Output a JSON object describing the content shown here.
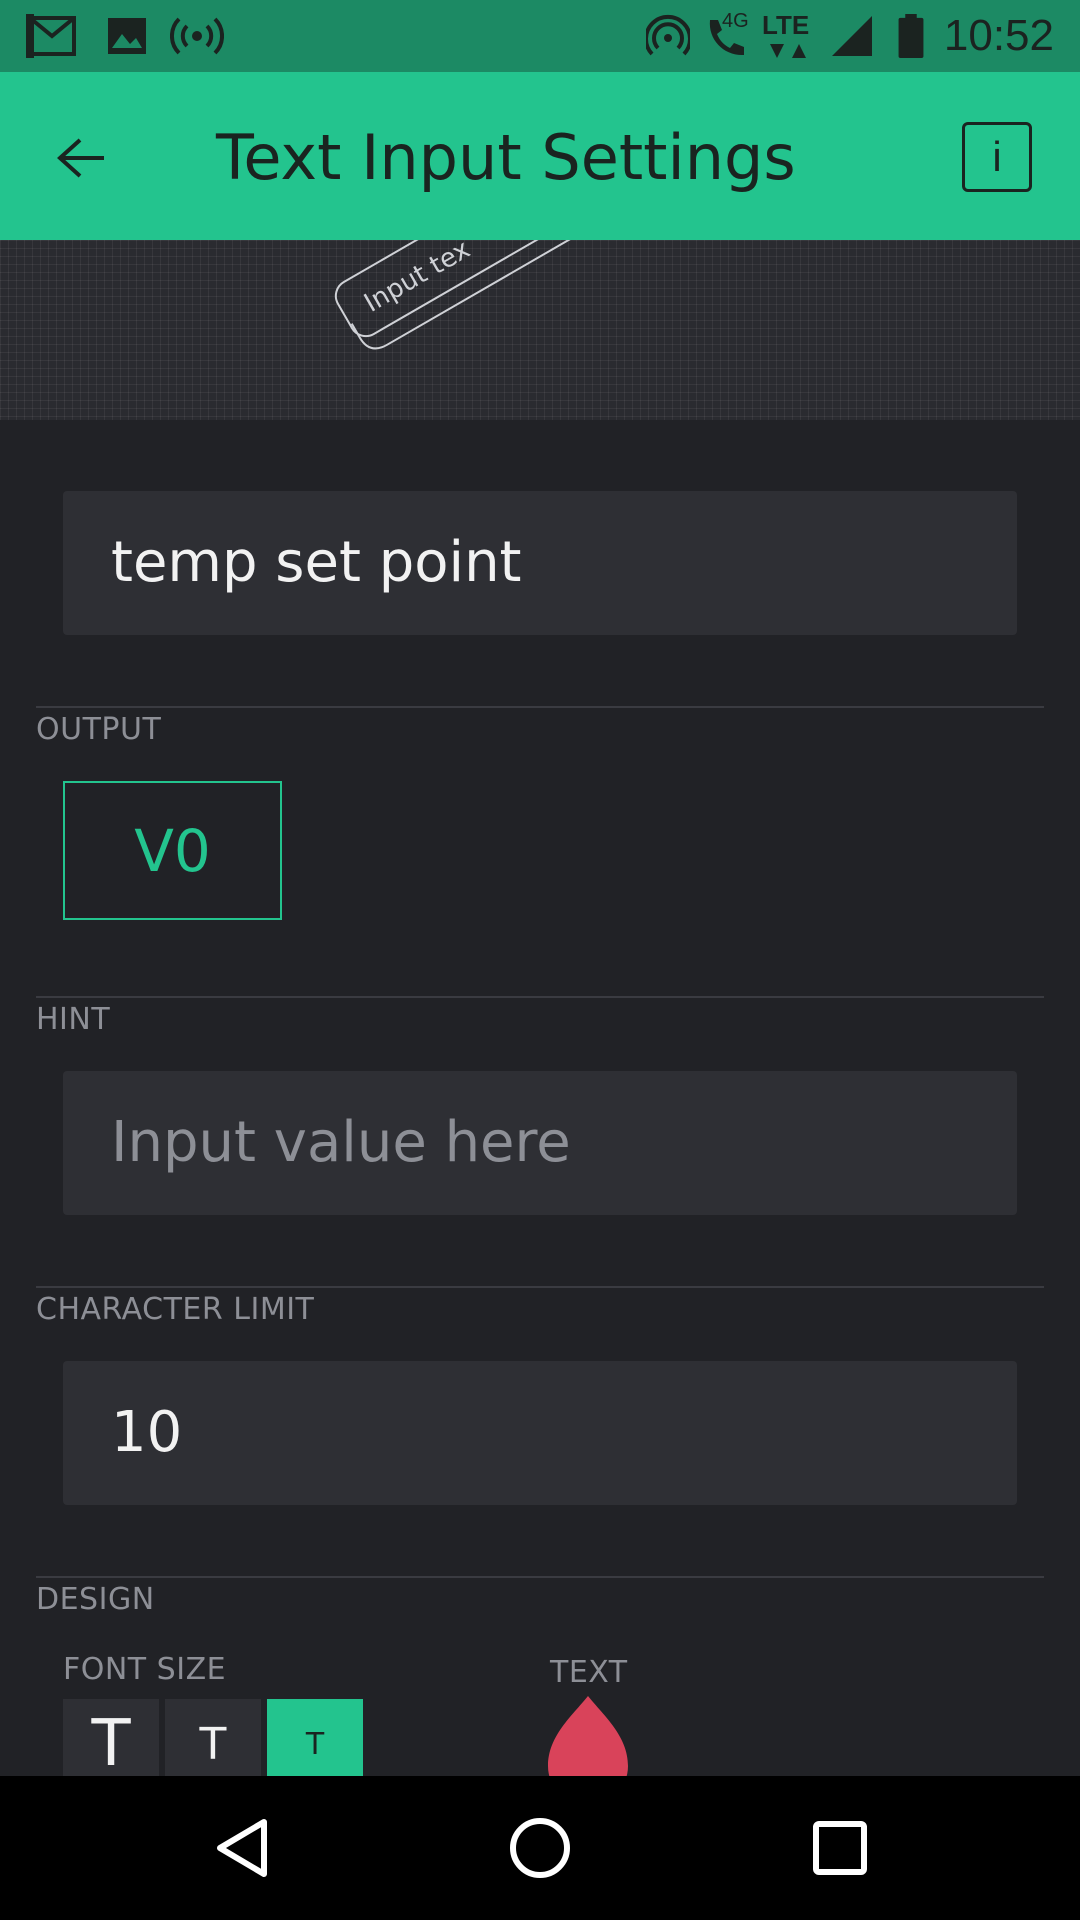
{
  "status_bar": {
    "time": "10:52",
    "icons": [
      "gmail-icon",
      "image-icon",
      "broadcast-icon",
      "hotspot-icon",
      "wifi-call-icon",
      "lte-icon",
      "signal-icon",
      "battery-icon"
    ],
    "network_4g": "4G",
    "network_lte": "LTE"
  },
  "app_bar": {
    "title": "Text Input Settings",
    "info_label": "i",
    "color": "#23c48e"
  },
  "preview": {
    "widget_text": "Input tex"
  },
  "name_field": {
    "value": "temp set point"
  },
  "output": {
    "label": "OUTPUT",
    "pin": "V0"
  },
  "hint": {
    "label": "HINT",
    "placeholder": "Input value here"
  },
  "character_limit": {
    "label": "CHARACTER LIMIT",
    "value": "10"
  },
  "design": {
    "label": "DESIGN",
    "font_size_label": "FONT SIZE",
    "font_sizes": [
      "T",
      "T",
      "T"
    ],
    "selected_font_size": 2,
    "text_color_label": "TEXT",
    "text_color": "#d9435a"
  },
  "colors": {
    "accent": "#23c48e",
    "background": "#212226",
    "field": "#2e2f34"
  }
}
